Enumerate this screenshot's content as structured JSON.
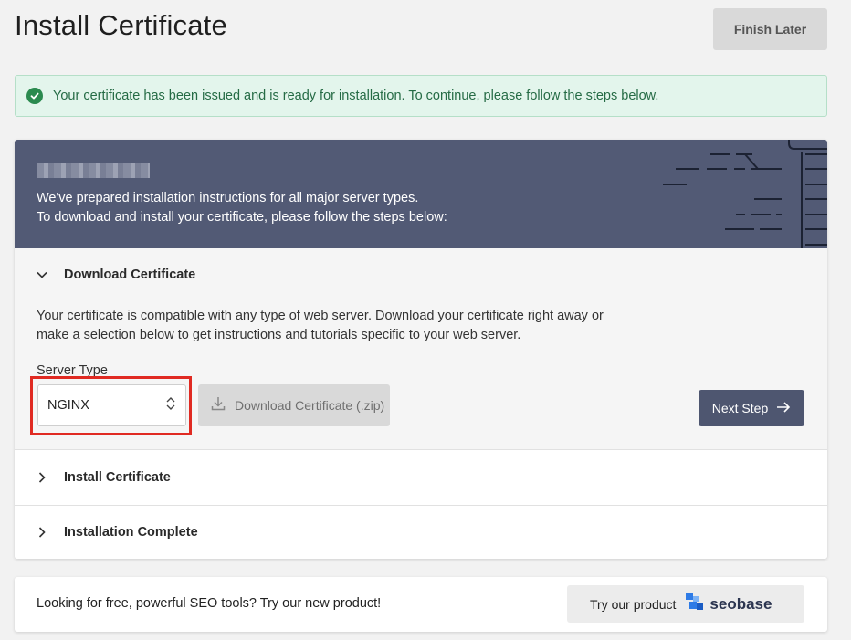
{
  "page": {
    "title": "Install Certificate",
    "finish_later_label": "Finish Later"
  },
  "alert": {
    "message": "Your certificate has been issued and is ready for installation. To continue, please follow the steps below.",
    "color": "#2b8a4f"
  },
  "banner": {
    "line1": "We've prepared installation instructions for all major server types.",
    "line2": "To download and install your certificate, please follow the steps below:",
    "background": "#525a75"
  },
  "steps": [
    {
      "title": "Download Certificate",
      "expanded": true,
      "description": "Your certificate is compatible with any type of web server. Download your certificate right away or make a selection below to get instructions and tutorials specific to your web server.",
      "server_type_label": "Server Type",
      "server_type_value": "NGINX",
      "download_label": "Download Certificate (.zip)",
      "next_label": "Next Step"
    },
    {
      "title": "Install Certificate",
      "expanded": false
    },
    {
      "title": "Installation Complete",
      "expanded": false
    }
  ],
  "promo": {
    "text": "Looking for free, powerful SEO tools? Try our new product!",
    "button_label": "Try our product",
    "brand": "seobase"
  },
  "icons": {
    "alert": "check-circle-icon",
    "expanded": "chevron-down-icon",
    "collapsed": "chevron-right-icon",
    "select": "up-down-chevron-icon",
    "download": "download-icon",
    "next": "arrow-right-icon",
    "brand": "seobase-logo-icon"
  }
}
